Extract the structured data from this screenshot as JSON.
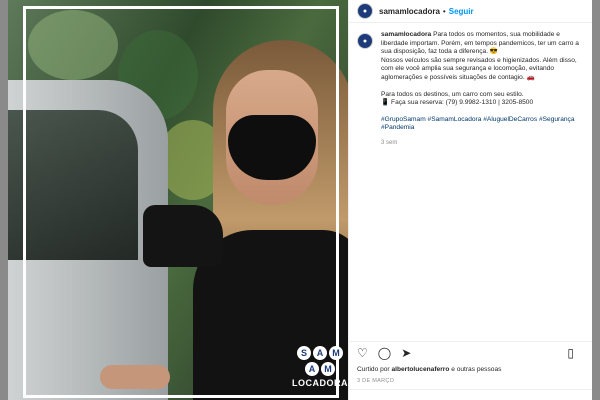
{
  "post": {
    "username": "samamlocadora",
    "separator": "•",
    "follow_label": "Seguir",
    "avatar_icon": "samam-logo-icon",
    "caption_lines": [
      "Para todos os momentos, sua mobilidade e liberdade importam. Porém, em tempos pandemicos, ter um carro a sua disposição, faz toda a diferença. 😎",
      "Nossos veículos são sempre revisados e higienizados. Além disso, com ele você amplia sua segurança e locomoção, evitando aglomerações e possíveis situações de contagio. 🚗",
      "Para todos os destinos, um carro com seu estilo.",
      "📱 Faça sua reserva: (79) 9.9982-1310 | 3205-8500"
    ],
    "hashtags": "#GrupoSamam #SamamLocadora #AluguelDeCarros #Segurança #Pandemia",
    "time_ago": "3 sem",
    "likes_prefix": "Curtido por ",
    "likes_user": "albertolucenaferro",
    "likes_suffix": " e outras pessoas",
    "date": "3 DE MARÇO"
  },
  "actions": {
    "like_icon": "heart-icon",
    "comment_icon": "comment-icon",
    "share_icon": "share-icon",
    "save_icon": "bookmark-icon",
    "like_glyph": "♡",
    "comment_glyph": "◯",
    "share_glyph": "➤",
    "save_glyph": "▯"
  },
  "image": {
    "logo_letters": [
      "S",
      "A",
      "M",
      "A",
      "M"
    ],
    "logo_text": "LOCADORA"
  },
  "colors": {
    "accent": "#0095f6",
    "hashtag": "#00376b",
    "brand": "#1d3b7a"
  }
}
